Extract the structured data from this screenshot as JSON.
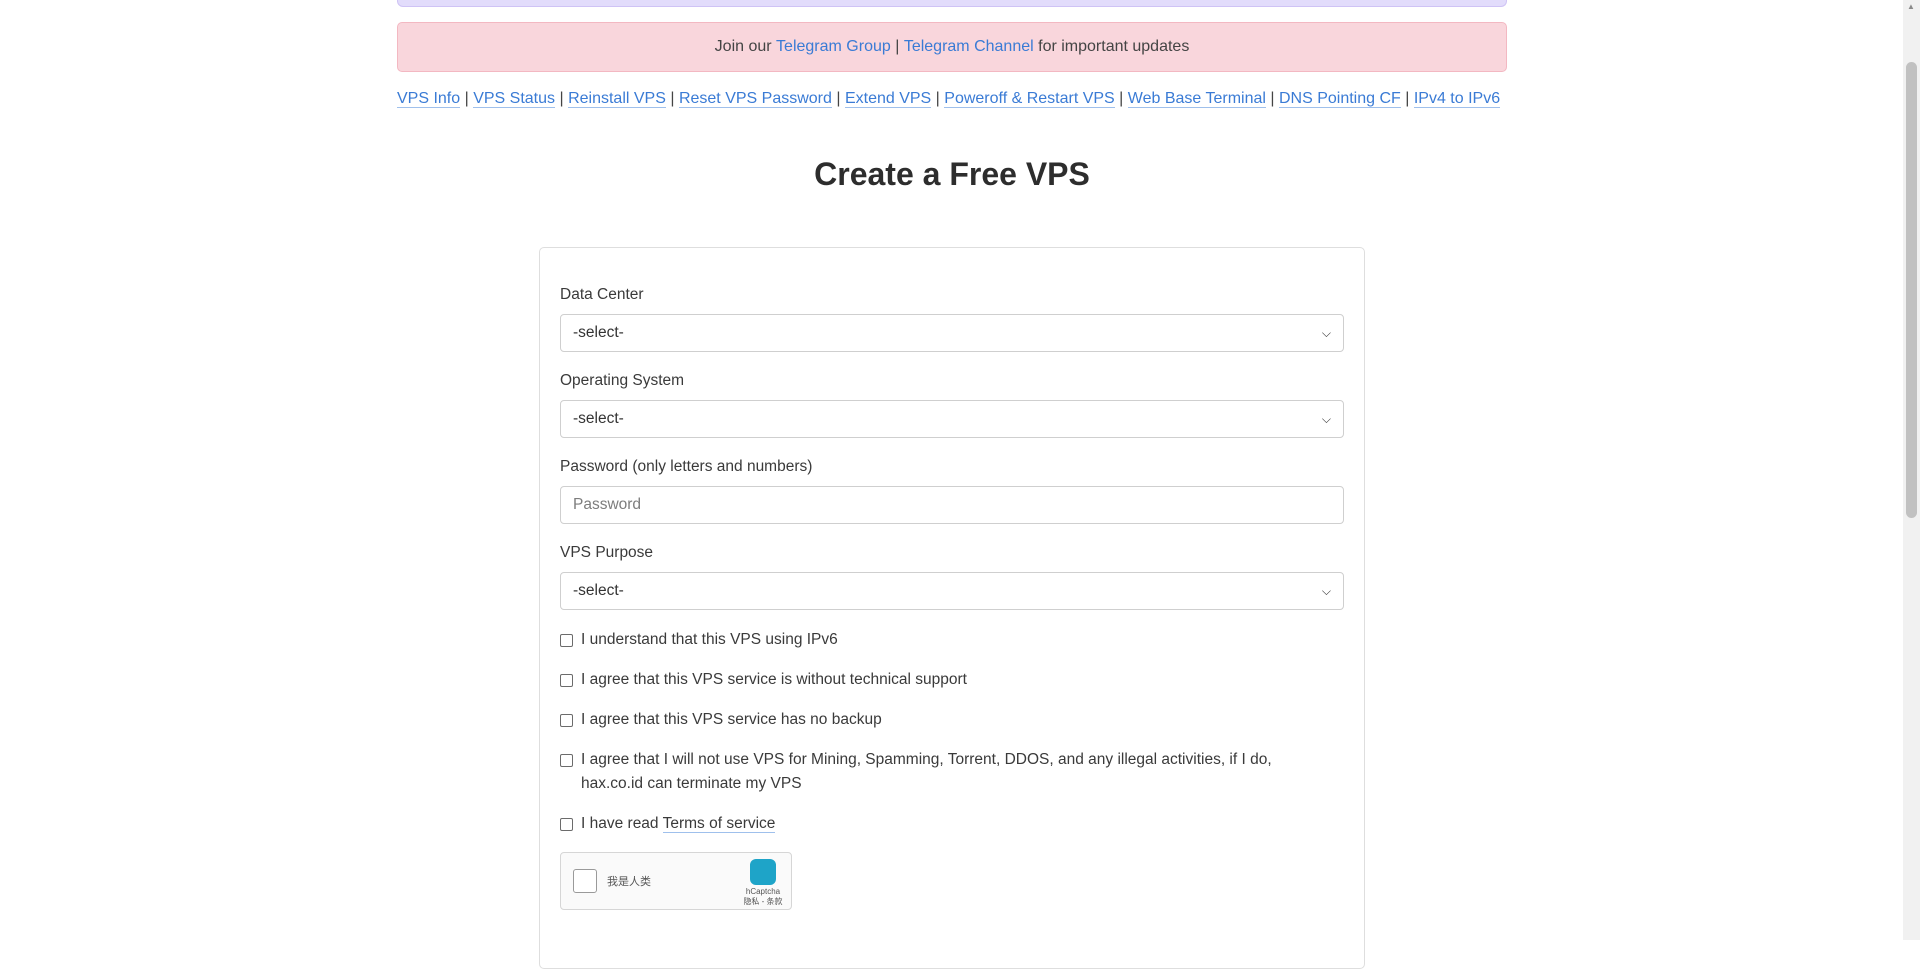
{
  "announcement": {
    "prefix": "Join our ",
    "link1": "Telegram Group",
    "separator": " | ",
    "link2": "Telegram Channel",
    "suffix": " for important updates"
  },
  "nav": {
    "sep": " | ",
    "items": [
      "VPS Info",
      "VPS Status",
      "Reinstall VPS",
      "Reset VPS Password",
      "Extend VPS",
      "Poweroff & Restart VPS",
      "Web Base Terminal",
      "DNS Pointing CF",
      "IPv4 to IPv6"
    ]
  },
  "title": "Create a Free VPS",
  "form": {
    "data_center": {
      "label": "Data Center",
      "value": "-select-"
    },
    "os": {
      "label": "Operating System",
      "value": "-select-"
    },
    "password": {
      "label": "Password (only letters and numbers)",
      "placeholder": "Password"
    },
    "purpose": {
      "label": "VPS Purpose",
      "value": "-select-"
    },
    "checks": [
      "I understand that this VPS using IPv6",
      "I agree that this VPS service is without technical support",
      "I agree that this VPS service has no backup",
      "I agree that I will not use VPS for Mining, Spamming, Torrent, DDOS, and any illegal activities, if I do,",
      "hax.co.id can terminate my VPS"
    ],
    "tos_prefix": "I have read ",
    "tos_link": "Terms of service"
  },
  "captcha": {
    "label": "我是人类",
    "brand": "hCaptcha",
    "privacy": "隐私 - 条款"
  },
  "colors": {
    "link": "#3a7bd5",
    "alert_bg": "#f9d6dc",
    "top_alert_bg": "#e2dcfb"
  }
}
